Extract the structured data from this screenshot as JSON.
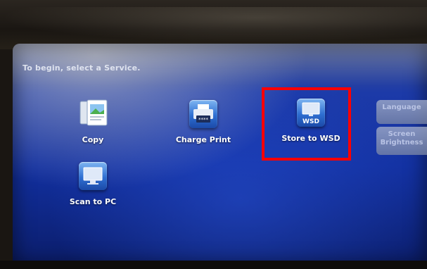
{
  "screen": {
    "prompt": "To begin, select a Service."
  },
  "services": [
    {
      "label": "Copy",
      "icon": "copy-icon"
    },
    {
      "label": "Charge Print",
      "icon": "printer-keypad-icon"
    },
    {
      "label": "Store to WSD",
      "icon": "monitor-wsd-icon",
      "icon_text": "WSD"
    },
    {
      "label": "Scan to PC",
      "icon": "monitor-icon"
    }
  ],
  "side_panel": {
    "language_label": "Language",
    "brightness_label": "Screen Brightness"
  },
  "colors": {
    "highlight": "#ff0000",
    "screen_blue": "#1230a0"
  }
}
